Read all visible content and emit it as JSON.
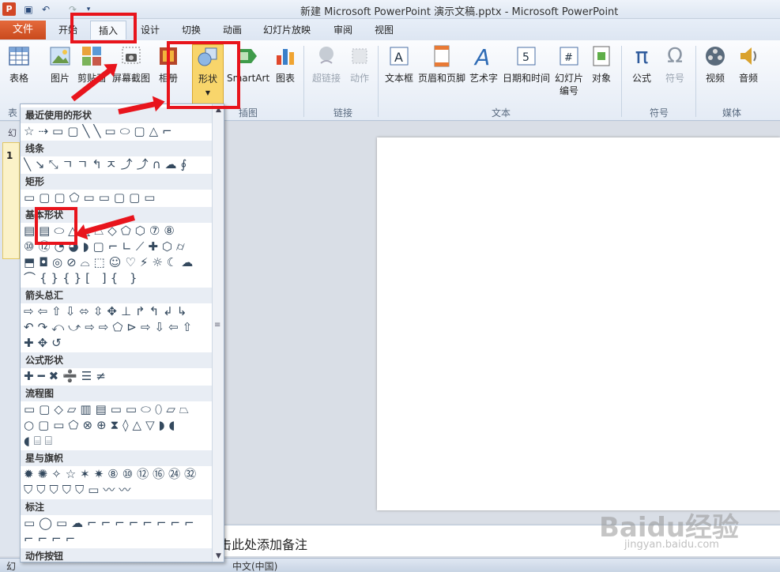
{
  "window": {
    "title": "新建 Microsoft PowerPoint 演示文稿.pptx - Microsoft PowerPoint",
    "app_icon": "P"
  },
  "tabs": {
    "file": "文件",
    "home": "开始",
    "insert": "插入",
    "design": "设计",
    "transitions": "切换",
    "animations": "动画",
    "slideshow": "幻灯片放映",
    "review": "审阅",
    "view": "视图"
  },
  "ribbon": {
    "table": "表格",
    "picture": "图片",
    "clipart": "剪贴画",
    "screenshot": "屏幕截图",
    "album": "相册",
    "shapes": "形状",
    "smartart": "SmartArt",
    "chart": "图表",
    "hyperlink": "超链接",
    "action": "动作",
    "textbox": "文本框",
    "header_footer": "页眉和页脚",
    "wordart": "艺术字",
    "datetime": "日期和时间",
    "slide_number_1": "幻灯片",
    "slide_number_2": "编号",
    "object": "对象",
    "equation": "公式",
    "symbol": "符号",
    "video": "视频",
    "audio": "音频",
    "groups": {
      "tables": "表",
      "illustrations": "插图",
      "links": "链接",
      "text": "文本",
      "symbols": "符号",
      "media": "媒体"
    }
  },
  "gallery": {
    "recent": "最近使用的形状",
    "lines": "线条",
    "rectangles": "矩形",
    "basic": "基本形状",
    "arrows": "箭头总汇",
    "equation": "公式形状",
    "flowchart": "流程图",
    "stars": "星与旗帜",
    "callouts": "标注",
    "action_buttons": "动作按钮"
  },
  "slide_panel": {
    "tab": "幻",
    "number": "1"
  },
  "notes": {
    "placeholder": "单击此处添加备注"
  },
  "status": {
    "slide": "幻",
    "language": "中文(中国)"
  },
  "watermark": {
    "main": "Baidu经验",
    "sub": "jingyan.baidu.com"
  },
  "colors": {
    "file_tab": "#d24726",
    "annotation": "#e8141c",
    "shapes_highlight": "#f8d56b"
  }
}
